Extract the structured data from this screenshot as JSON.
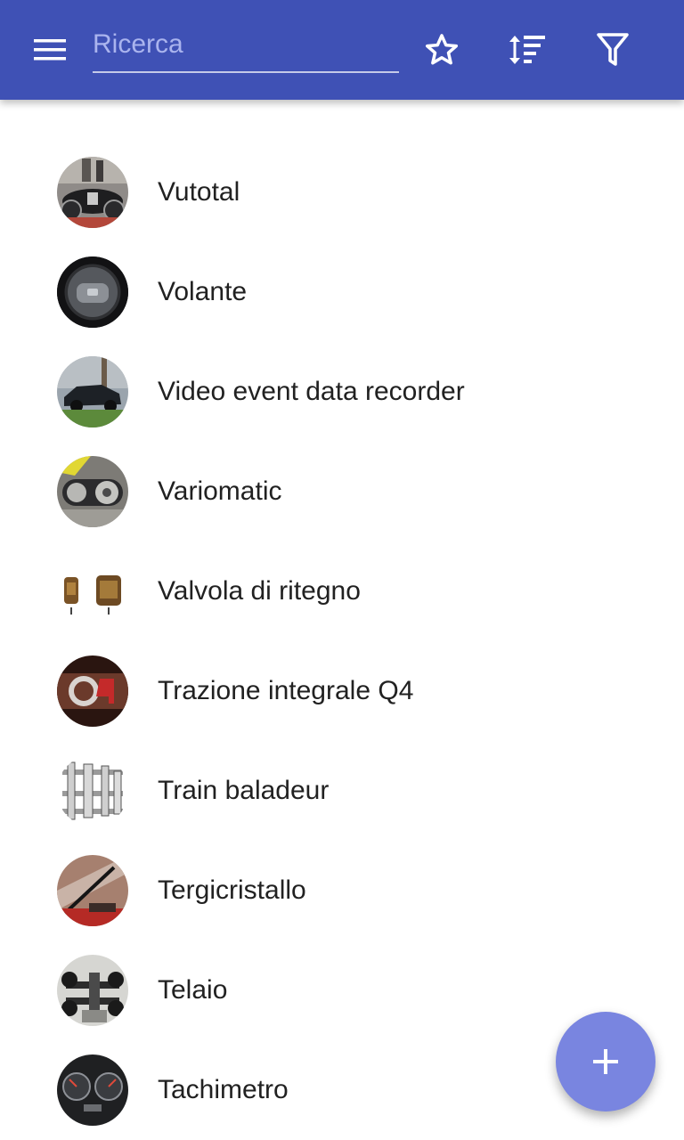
{
  "colors": {
    "toolbar": "#3f51b5",
    "fab": "#7985e0",
    "text": "#212121",
    "placeholder": "#aab4ee"
  },
  "toolbar": {
    "menu_icon": "hamburger-menu-icon",
    "search_placeholder": "Ricerca",
    "search_value": "",
    "actions": [
      {
        "icon": "star-outline-icon"
      },
      {
        "icon": "sort-icon"
      },
      {
        "icon": "filter-icon"
      }
    ]
  },
  "items": [
    {
      "label": "Vutotal",
      "thumb": "vintage-car-photo"
    },
    {
      "label": "Volante",
      "thumb": "steering-wheel-photo"
    },
    {
      "label": "Video event data recorder",
      "thumb": "crashed-car-photo"
    },
    {
      "label": "Variomatic",
      "thumb": "cvt-transmission-photo"
    },
    {
      "label": "Valvola di ritegno",
      "thumb": "check-valve-photo"
    },
    {
      "label": "Trazione integrale Q4",
      "thumb": "q4-badge-photo"
    },
    {
      "label": "Train baladeur",
      "thumb": "gearbox-drawing"
    },
    {
      "label": "Tergicristallo",
      "thumb": "windshield-wiper-photo"
    },
    {
      "label": "Telaio",
      "thumb": "chassis-photo"
    },
    {
      "label": "Tachimetro",
      "thumb": "speedometer-photo"
    }
  ],
  "fab": {
    "icon": "plus-icon"
  }
}
